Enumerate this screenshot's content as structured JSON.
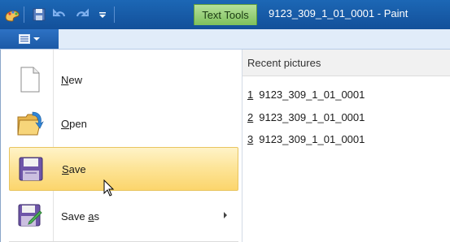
{
  "titlebar": {
    "context_tab": "Text Tools",
    "title": "9123_309_1_01_0001 - Paint",
    "qat_icons": [
      "paint-app-icon",
      "save-icon",
      "undo-icon",
      "redo-icon",
      "customize-qat-icon"
    ]
  },
  "ribbon": {
    "file_button_icon": "paint-menu-icon"
  },
  "menu": {
    "items": [
      {
        "pre": "",
        "key": "N",
        "post": "ew",
        "icon": "new-document-icon"
      },
      {
        "pre": "",
        "key": "O",
        "post": "pen",
        "icon": "open-folder-icon"
      },
      {
        "pre": "",
        "key": "S",
        "post": "ave",
        "icon": "save-icon"
      },
      {
        "pre": "Save ",
        "key": "a",
        "post": "s",
        "icon": "save-as-icon",
        "has_submenu": true
      }
    ],
    "selected_index": 2
  },
  "recent": {
    "heading": "Recent pictures",
    "items": [
      {
        "num": "1",
        "name": "9123_309_1_01_0001"
      },
      {
        "num": "2",
        "name": "9123_309_1_01_0001"
      },
      {
        "num": "3",
        "name": "9123_309_1_01_0001"
      }
    ]
  },
  "colors": {
    "titlebar": "#1c67b5",
    "context_tab": "#8fcb6d",
    "selected_item": "#fde59a"
  }
}
